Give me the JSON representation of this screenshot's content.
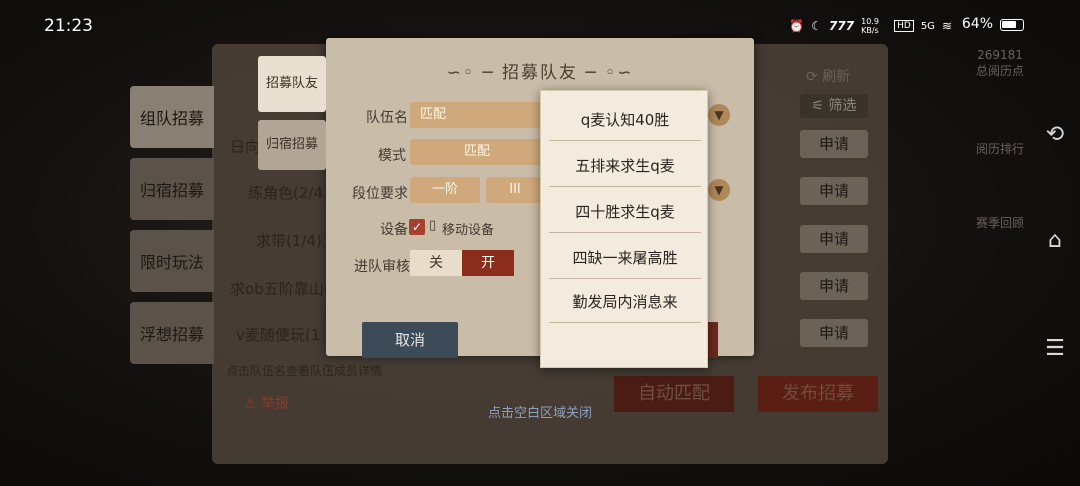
{
  "status": {
    "time": "21:23",
    "network_speed": "10.9 KB/s",
    "hd": "HD",
    "signal": "5G",
    "battery": "64%",
    "icons": [
      "alarm-icon",
      "moon-icon",
      "speed-icon",
      "hd-icon",
      "signal-5g-icon",
      "wifi-icon",
      "battery-icon"
    ]
  },
  "nav": {
    "icons": [
      "back-icon",
      "home-icon",
      "menu-icon"
    ]
  },
  "left_tabs": [
    "组队招募",
    "归宿招募",
    "限时玩法",
    "浮想招募"
  ],
  "background": {
    "refresh": "刷新",
    "filter": "筛选",
    "rows": [
      "日向",
      "练角色(2/4",
      "求带(1/4)",
      "求ob五阶靠山(",
      "v麦随便玩(1"
    ],
    "apply_label": "申请",
    "hint": "点击队伍名查看队伍成员详情",
    "report": "举报",
    "auto_match": "自动匹配",
    "publish": "发布招募",
    "close_hint": "点击空白区域关闭",
    "right_links": [
      "总阅历点",
      "阅历排行",
      "赛季回顾"
    ],
    "right_number": "269181"
  },
  "dialog": {
    "title": "招募队友",
    "tab_recruit": "招募队友",
    "tab_home": "归宿招募",
    "team_name_label": "队伍名",
    "team_name_value": "匹配",
    "mode_label": "模式",
    "mode_value": "匹配",
    "rank_label": "段位要求",
    "rank_value_1": "一阶",
    "rank_value_2": "III",
    "device_label": "设备",
    "device_option": "移动设备",
    "review_label": "进队审核",
    "toggle_off": "关",
    "toggle_on": "开",
    "cancel": "取消"
  },
  "menu": {
    "items": [
      "q麦认知40胜",
      "五排来求生q麦",
      "四十胜求生q麦",
      "四缺一来屠高胜",
      "勤发局内消息来"
    ]
  }
}
